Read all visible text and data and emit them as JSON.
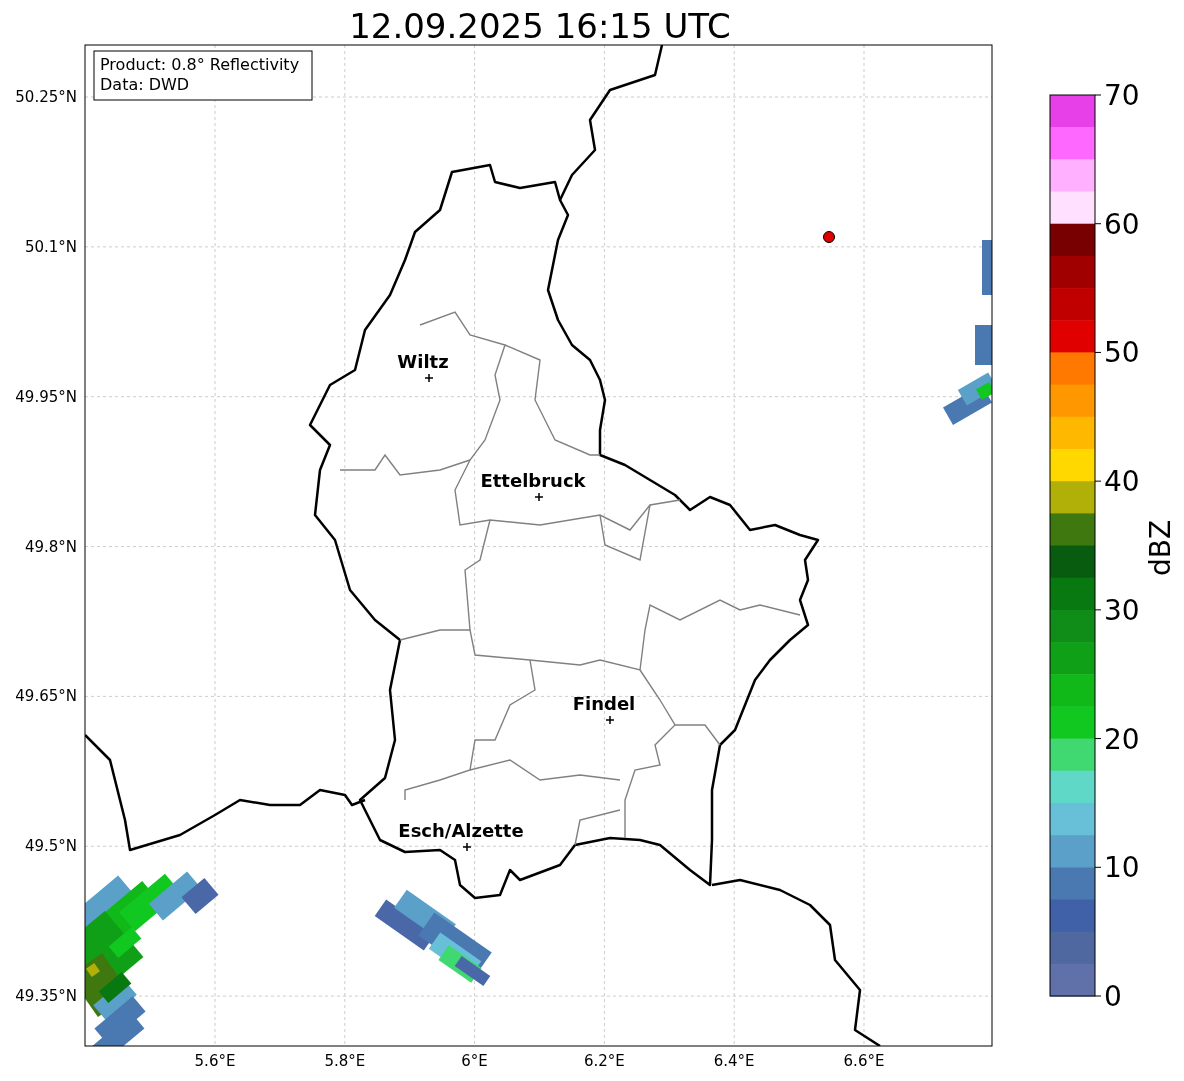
{
  "title": "12.09.2025 16:15 UTC",
  "info_box": [
    "Product: 0.8° Reflectivity",
    "Data: DWD"
  ],
  "map": {
    "lon_labels": [
      "5.6°E",
      "5.8°E",
      "6°E",
      "6.2°E",
      "6.4°E",
      "6.6°E"
    ],
    "lat_labels": [
      "50.25°N",
      "50.1°N",
      "49.95°N",
      "49.8°N",
      "49.65°N",
      "49.5°N",
      "49.35°N"
    ],
    "cities": [
      {
        "name": "Wiltz"
      },
      {
        "name": "Ettelbruck"
      },
      {
        "name": "Findel"
      },
      {
        "name": "Esch/Alzette"
      }
    ]
  },
  "colorbar": {
    "label": "dBZ",
    "ticks": [
      "70",
      "60",
      "50",
      "40",
      "30",
      "20",
      "10",
      "0"
    ],
    "bins": [
      {
        "color": "#e840e8"
      },
      {
        "color": "#ff68ff"
      },
      {
        "color": "#ffb0ff"
      },
      {
        "color": "#ffe0ff"
      },
      {
        "color": "#780000"
      },
      {
        "color": "#a00000"
      },
      {
        "color": "#c00000"
      },
      {
        "color": "#e00000"
      },
      {
        "color": "#ff7800"
      },
      {
        "color": "#ff9800"
      },
      {
        "color": "#ffb800"
      },
      {
        "color": "#ffd800"
      },
      {
        "color": "#b0b008"
      },
      {
        "color": "#407810"
      },
      {
        "color": "#085c10"
      },
      {
        "color": "#087810"
      },
      {
        "color": "#108c18"
      },
      {
        "color": "#10a018"
      },
      {
        "color": "#10b818"
      },
      {
        "color": "#10c820"
      },
      {
        "color": "#40d870"
      },
      {
        "color": "#60d8c8"
      },
      {
        "color": "#68c0d8"
      },
      {
        "color": "#5aa0c8"
      },
      {
        "color": "#4a78b0"
      },
      {
        "color": "#4060a8"
      },
      {
        "color": "#5068a0"
      },
      {
        "color": "#6070a8"
      }
    ]
  }
}
